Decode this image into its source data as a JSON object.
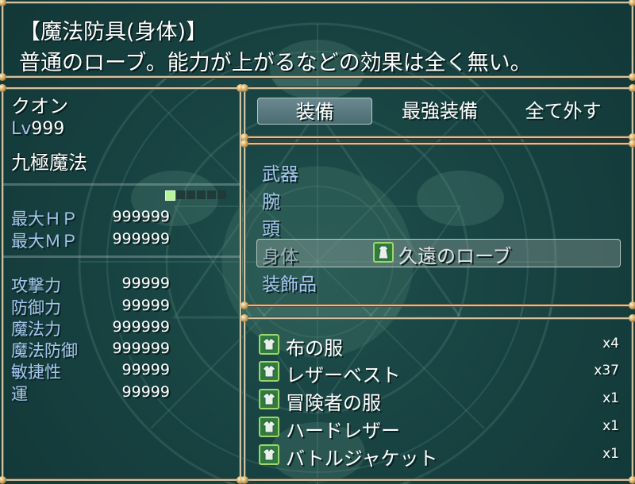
{
  "help": {
    "line1": "【魔法防具(身体)】",
    "line2": "普通のローブ。能力が上がるなどの効果は全く無い。"
  },
  "actor": {
    "name": "クオン",
    "level_label": "Lv",
    "level": "999",
    "class": "九極魔法"
  },
  "stats": [
    {
      "label": "最大ＨＰ",
      "value": "999999"
    },
    {
      "label": "最大ＭＰ",
      "value": "999999"
    },
    {
      "label": "攻撃力",
      "value": "99999"
    },
    {
      "label": "防御力",
      "value": "99999"
    },
    {
      "label": "魔法力",
      "value": "999999"
    },
    {
      "label": "魔法防御",
      "value": "999999"
    },
    {
      "label": "敏捷性",
      "value": "99999"
    },
    {
      "label": "運",
      "value": "99999"
    }
  ],
  "commands": [
    {
      "label": "装備"
    },
    {
      "label": "最強装備"
    },
    {
      "label": "全て外す"
    }
  ],
  "selected_command": 0,
  "slots": [
    {
      "label": "武器",
      "item": ""
    },
    {
      "label": "腕",
      "item": ""
    },
    {
      "label": "頭",
      "item": ""
    },
    {
      "label": "身体",
      "item": "久遠のローブ"
    },
    {
      "label": "装飾品",
      "item": ""
    }
  ],
  "selected_slot": 3,
  "items": [
    {
      "name": "布の服",
      "qty": "x4",
      "icon": "armor-icon"
    },
    {
      "name": "レザーベスト",
      "qty": "x37",
      "icon": "armor-icon"
    },
    {
      "name": "冒険者の服",
      "qty": "x1",
      "icon": "armor-icon"
    },
    {
      "name": "ハードレザー",
      "qty": "x1",
      "icon": "armor-icon"
    },
    {
      "name": "バトルジャケット",
      "qty": "x1",
      "icon": "armor-icon"
    }
  ],
  "colors": {
    "system_blue": "#a5c6ee",
    "window_border": "#cfc3a6",
    "background": "#1c4a48",
    "icon_green": "#2f7d3a"
  }
}
